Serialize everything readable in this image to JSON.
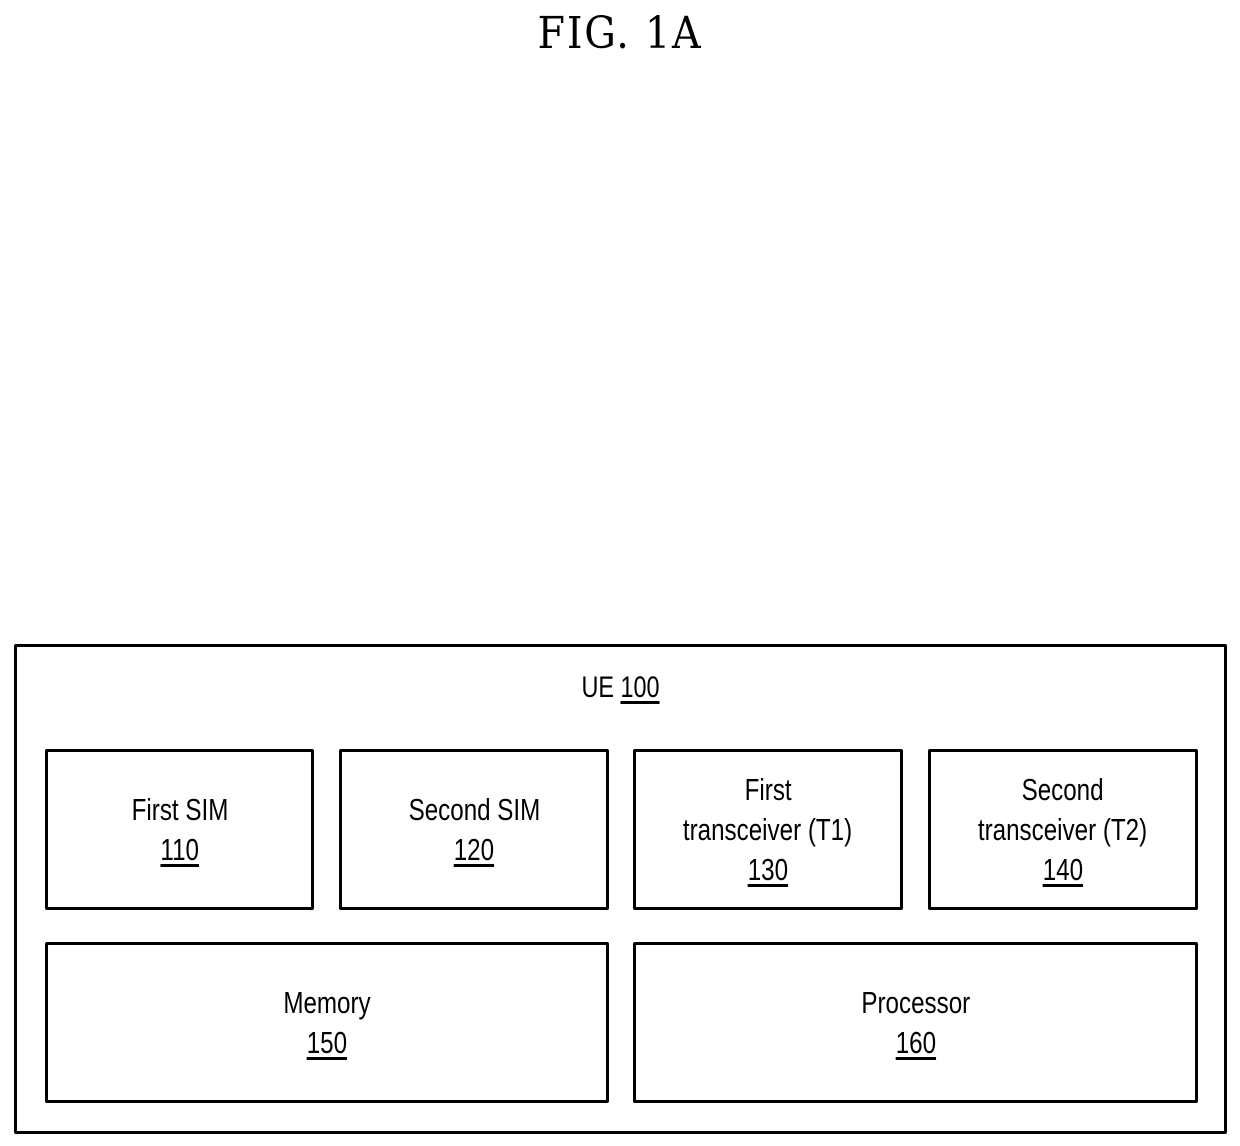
{
  "figure": {
    "title": "FIG. 1A"
  },
  "ue": {
    "label": "UE",
    "ref": "100"
  },
  "components": [
    {
      "lines": [
        "First SIM"
      ],
      "ref": "110"
    },
    {
      "lines": [
        "Second SIM"
      ],
      "ref": "120"
    },
    {
      "lines": [
        "First",
        "transceiver (T1)"
      ],
      "ref": "130"
    },
    {
      "lines": [
        "Second",
        "transceiver (T2)"
      ],
      "ref": "140"
    },
    {
      "lines": [
        "Memory"
      ],
      "ref": "150"
    },
    {
      "lines": [
        "Processor"
      ],
      "ref": "160"
    }
  ]
}
